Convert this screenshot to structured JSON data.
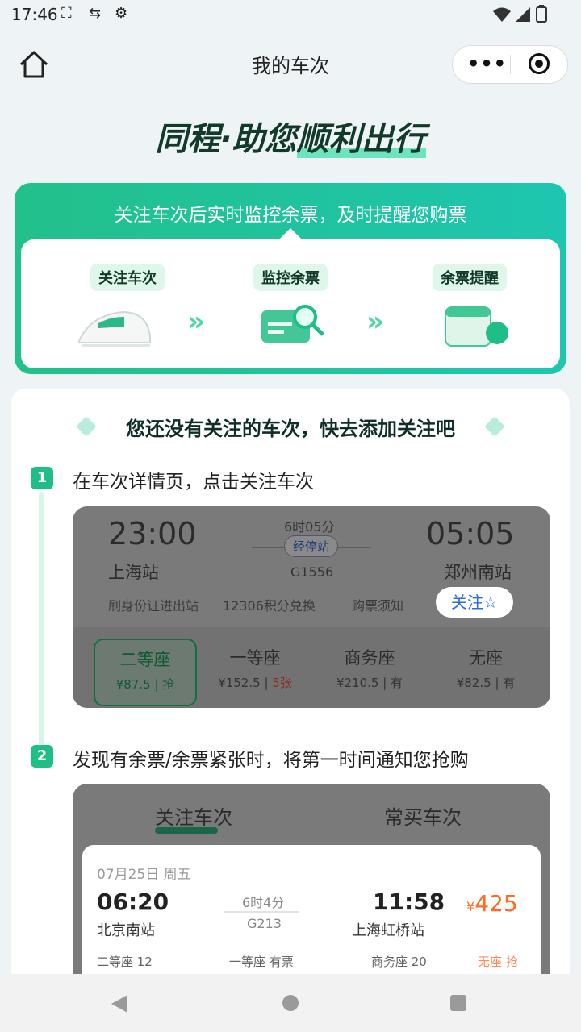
{
  "status_bar": {
    "time": "17:46",
    "icons": [
      "cast-icon",
      "shuffle-icon",
      "gear-icon",
      "wifi-icon",
      "signal-icon",
      "battery-icon"
    ]
  },
  "header": {
    "title": "我的车次"
  },
  "slogan": {
    "part1": "同程·助您",
    "part2": "顺利出行"
  },
  "promo": {
    "headline": "关注车次后实时监控余票，及时提醒您购票",
    "steps": [
      "关注车次",
      "监控余票",
      "余票提醒"
    ]
  },
  "main": {
    "empty_title": "您还没有关注的车次，快去添加关注吧",
    "step1": {
      "num": "1",
      "text": "在车次详情页，点击关注车次"
    },
    "step2": {
      "num": "2",
      "text": "发现有余票/余票紧张时，将第一时间通知您抢购"
    }
  },
  "demo1": {
    "depart_time": "23:00",
    "arrive_time": "05:05",
    "duration": "6时05分",
    "stop_label": "经停站",
    "train_no": "G1556",
    "from": "上海站",
    "to": "郑州南站",
    "info": [
      "刷身份证进出站",
      "12306积分兑换",
      "购票须知"
    ],
    "follow_label": "关注☆",
    "seats": [
      {
        "name": "二等座",
        "price": "¥87.5",
        "status": "抢"
      },
      {
        "name": "一等座",
        "price": "¥152.5",
        "status": "5张"
      },
      {
        "name": "商务座",
        "price": "¥210.5",
        "status": "有"
      },
      {
        "name": "无座",
        "price": "¥82.5",
        "status": "有"
      }
    ]
  },
  "demo2": {
    "tabs": [
      "关注车次",
      "常买车次"
    ],
    "date": "07月25日 周五",
    "depart_time": "06:20",
    "arrive_time": "11:58",
    "duration": "6时4分",
    "train_no": "G213",
    "from": "北京南站",
    "to": "上海虹桥站",
    "price_symbol": "¥",
    "price": "425",
    "classes": [
      "二等座 12",
      "一等座 有票",
      "商务座 20",
      "无座 抢"
    ]
  },
  "colors": {
    "accent": "#1dbf86",
    "price": "#ff6a26",
    "follow": "#2d6cdf"
  }
}
